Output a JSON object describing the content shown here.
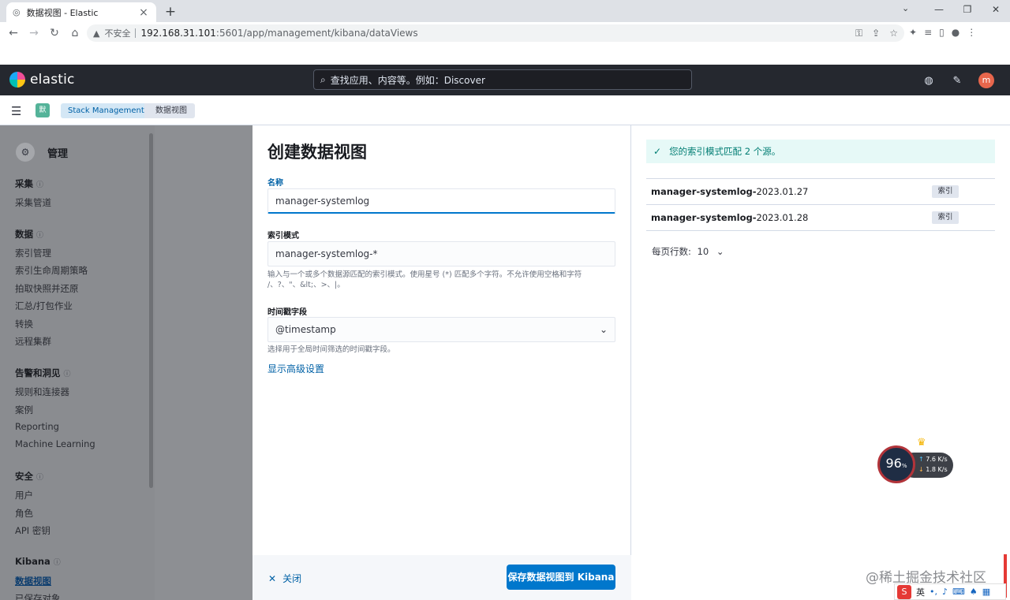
{
  "browser": {
    "tab_title": "数据视图 - Elastic",
    "security_warning": "不安全",
    "url_host": "192.168.31.101",
    "url_path": ":5601/app/management/kibana/dataViews"
  },
  "header": {
    "logo_text": "elastic",
    "search_placeholder": "查找应用、内容等。例如：Discover",
    "avatar_letter": "m"
  },
  "breadcrumb": {
    "space_badge": "默",
    "items": [
      "Stack Management",
      "数据视图"
    ]
  },
  "sidenav": {
    "title": "管理",
    "groups": [
      {
        "label": "采集",
        "items": [
          "采集管道"
        ]
      },
      {
        "label": "数据",
        "items": [
          "索引管理",
          "索引生命周期策略",
          "拍取快照并还原",
          "汇总/打包作业",
          "转换",
          "远程集群"
        ]
      },
      {
        "label": "告警和洞见",
        "items": [
          "规则和连接器",
          "案例",
          "Reporting",
          "Machine Learning"
        ]
      },
      {
        "label": "安全",
        "items": [
          "用户",
          "角色",
          "API 密钥"
        ]
      },
      {
        "label": "Kibana",
        "items": [
          "数据视图",
          "已保存对象"
        ]
      }
    ]
  },
  "form": {
    "title": "创建数据视图",
    "name_label": "名称",
    "name_value": "manager-systemlog",
    "pattern_label": "索引模式",
    "pattern_value": "manager-systemlog-*",
    "pattern_help_1": "输入与一个或多个数据源匹配的索引模式。使用星号 (*) 匹配多个字符。不允许使用空格和字符",
    "pattern_help_2": "/、?、\"、&lt;、>、|。",
    "timestamp_label": "时间戳字段",
    "timestamp_value": "@timestamp",
    "timestamp_help": "选择用于全局时间筛选的时间戳字段。",
    "advanced_link": "显示高级设置",
    "close_label": "关闭",
    "save_label": "保存数据视图到 Kibana"
  },
  "preview": {
    "callout": "您的索引模式匹配 2 个源。",
    "rows": [
      {
        "prefix": "manager-systemlog-",
        "suffix": "2023.01.27",
        "badge": "索引"
      },
      {
        "prefix": "manager-systemlog-",
        "suffix": "2023.01.28",
        "badge": "索引"
      }
    ],
    "rows_per_page_label": "每页行数:",
    "rows_per_page_value": "10"
  },
  "net_widget": {
    "percent": "96",
    "percent_unit": "%",
    "up_speed": "7.6",
    "down_speed": "1.8",
    "speed_unit": "K/s"
  },
  "watermark": "@稀土掘金技术社区",
  "ime_label": "英"
}
